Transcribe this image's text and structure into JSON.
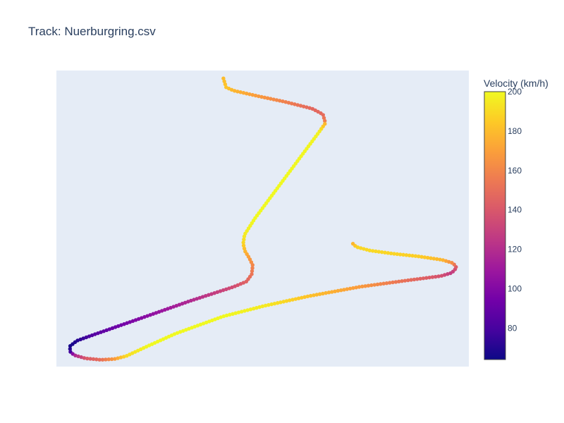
{
  "chart_data": {
    "type": "scatter",
    "title": "Track: Nuerburgring.csv",
    "xlabel": "",
    "ylabel": "",
    "axes_visible": false,
    "grid": false,
    "colorbar": {
      "title": "Velocity (km/h)",
      "min": 64,
      "max": 200,
      "tick_values": [
        80,
        100,
        120,
        140,
        160,
        180,
        200
      ],
      "tick_labels": [
        "80",
        "100",
        "120",
        "140",
        "160",
        "180",
        "200"
      ],
      "colorscale": "plasma"
    },
    "waypoints": [
      {
        "x": 0.0,
        "y": 2.0,
        "v": 180
      },
      {
        "x": 0.08,
        "y": -0.5,
        "v": 183
      },
      {
        "x": 0.3,
        "y": -1.4,
        "v": 178
      },
      {
        "x": 1.0,
        "y": -2.9,
        "v": 168
      },
      {
        "x": 1.8,
        "y": -4.5,
        "v": 158
      },
      {
        "x": 2.6,
        "y": -6.4,
        "v": 147
      },
      {
        "x": 2.92,
        "y": -8.0,
        "v": 148
      },
      {
        "x": 2.98,
        "y": -10.0,
        "v": 158
      },
      {
        "x": 2.98,
        "y": -10.6,
        "v": 178
      },
      {
        "x": 2.8,
        "y": -13.0,
        "v": 198
      },
      {
        "x": 1.86,
        "y": -25.0,
        "v": 200
      },
      {
        "x": 0.92,
        "y": -37.0,
        "v": 200
      },
      {
        "x": 0.62,
        "y": -41.5,
        "v": 196
      },
      {
        "x": 0.58,
        "y": -44.0,
        "v": 188
      },
      {
        "x": 0.63,
        "y": -46.0,
        "v": 178
      },
      {
        "x": 0.76,
        "y": -48.0,
        "v": 168
      },
      {
        "x": 0.86,
        "y": -50.0,
        "v": 160
      },
      {
        "x": 0.83,
        "y": -52.5,
        "v": 153
      },
      {
        "x": 0.68,
        "y": -54.5,
        "v": 145
      },
      {
        "x": 0.3,
        "y": -56.0,
        "v": 135
      },
      {
        "x": -1.0,
        "y": -60.0,
        "v": 118
      },
      {
        "x": -2.5,
        "y": -65.0,
        "v": 100
      },
      {
        "x": -3.8,
        "y": -69.3,
        "v": 85
      },
      {
        "x": -4.3,
        "y": -71.0,
        "v": 70
      },
      {
        "x": -4.5,
        "y": -72.5,
        "v": 66
      },
      {
        "x": -4.5,
        "y": -74.0,
        "v": 74
      },
      {
        "x": -4.38,
        "y": -75.0,
        "v": 115
      },
      {
        "x": -4.05,
        "y": -75.9,
        "v": 140
      },
      {
        "x": -3.6,
        "y": -76.3,
        "v": 150
      },
      {
        "x": -3.2,
        "y": -76.1,
        "v": 168
      },
      {
        "x": -2.86,
        "y": -75.3,
        "v": 190
      },
      {
        "x": -2.2,
        "y": -72.4,
        "v": 200
      },
      {
        "x": -1.4,
        "y": -69.0,
        "v": 200
      },
      {
        "x": 0.0,
        "y": -64.2,
        "v": 200
      },
      {
        "x": 1.2,
        "y": -61.3,
        "v": 195
      },
      {
        "x": 2.5,
        "y": -58.6,
        "v": 182
      },
      {
        "x": 4.0,
        "y": -56.0,
        "v": 168
      },
      {
        "x": 5.4,
        "y": -54.2,
        "v": 150
      },
      {
        "x": 6.38,
        "y": -53.0,
        "v": 137
      },
      {
        "x": 6.7,
        "y": -52.1,
        "v": 126
      },
      {
        "x": 6.84,
        "y": -50.7,
        "v": 138
      },
      {
        "x": 6.74,
        "y": -49.4,
        "v": 160
      },
      {
        "x": 6.42,
        "y": -48.5,
        "v": 178
      },
      {
        "x": 5.7,
        "y": -47.5,
        "v": 186
      },
      {
        "x": 5.0,
        "y": -46.8,
        "v": 188
      },
      {
        "x": 4.3,
        "y": -45.9,
        "v": 190
      },
      {
        "x": 3.9,
        "y": -44.9,
        "v": 188
      },
      {
        "x": 3.8,
        "y": -44.0,
        "v": 178
      }
    ],
    "n_points": 330,
    "xlim": [
      -4.9,
      7.2
    ],
    "ylim": [
      -78.2,
      4.2
    ]
  }
}
